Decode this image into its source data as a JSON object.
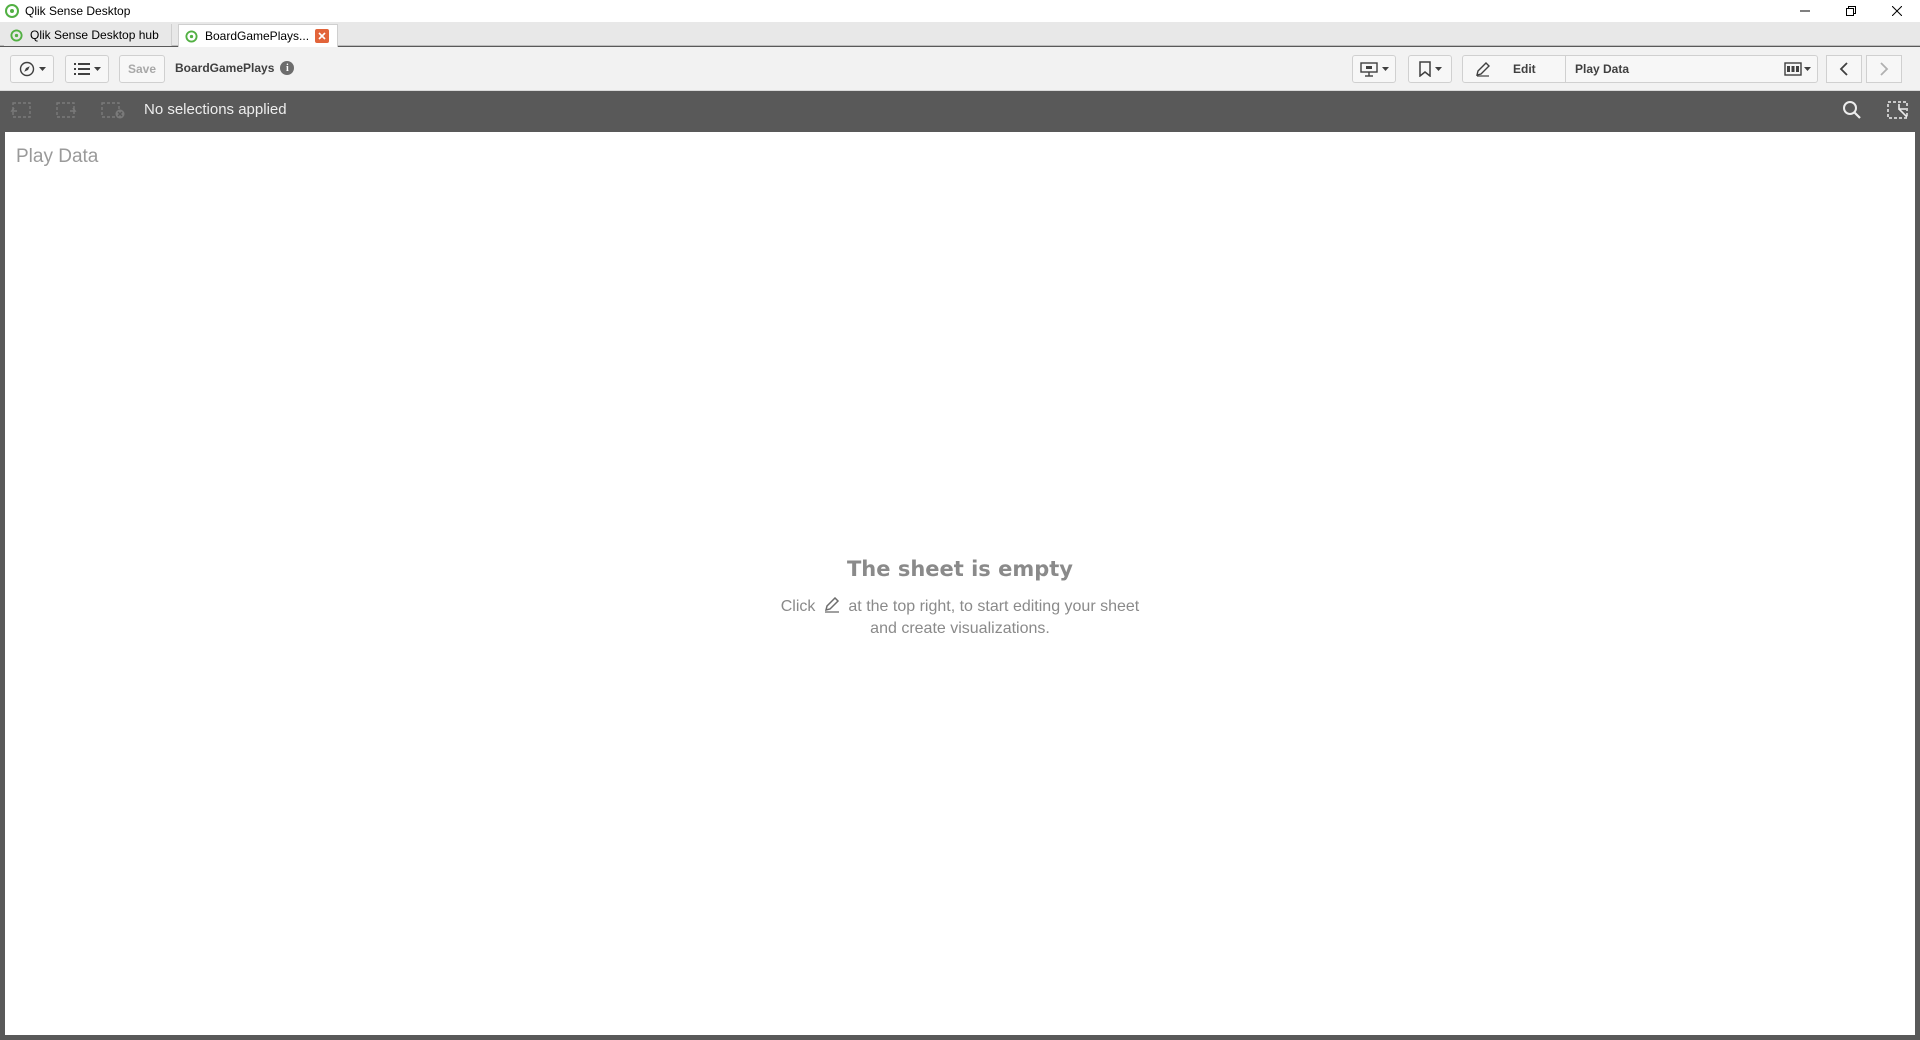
{
  "window": {
    "title": "Qlik Sense Desktop",
    "controls": [
      "minimize-icon",
      "restore-icon",
      "close-icon"
    ]
  },
  "tabs": [
    {
      "label": "Qlik Sense Desktop hub",
      "active": false
    },
    {
      "label": "BoardGamePlays...",
      "active": true
    }
  ],
  "toolbar": {
    "save_label": "Save",
    "app_name": "BoardGamePlays",
    "info_glyph": "i",
    "edit_label": "Edit",
    "sheet_name": "Play Data"
  },
  "selections": {
    "status_text": "No selections applied"
  },
  "sheet": {
    "title": "Play Data",
    "empty_title": "The sheet is empty",
    "empty_prefix": "Click",
    "empty_suffix": "at the top right, to start editing your sheet",
    "empty_line2": "and create visualizations."
  },
  "colors": {
    "accent_green": "#52b043",
    "close_tab_red": "#e2643a",
    "selection_bar": "#595959"
  }
}
